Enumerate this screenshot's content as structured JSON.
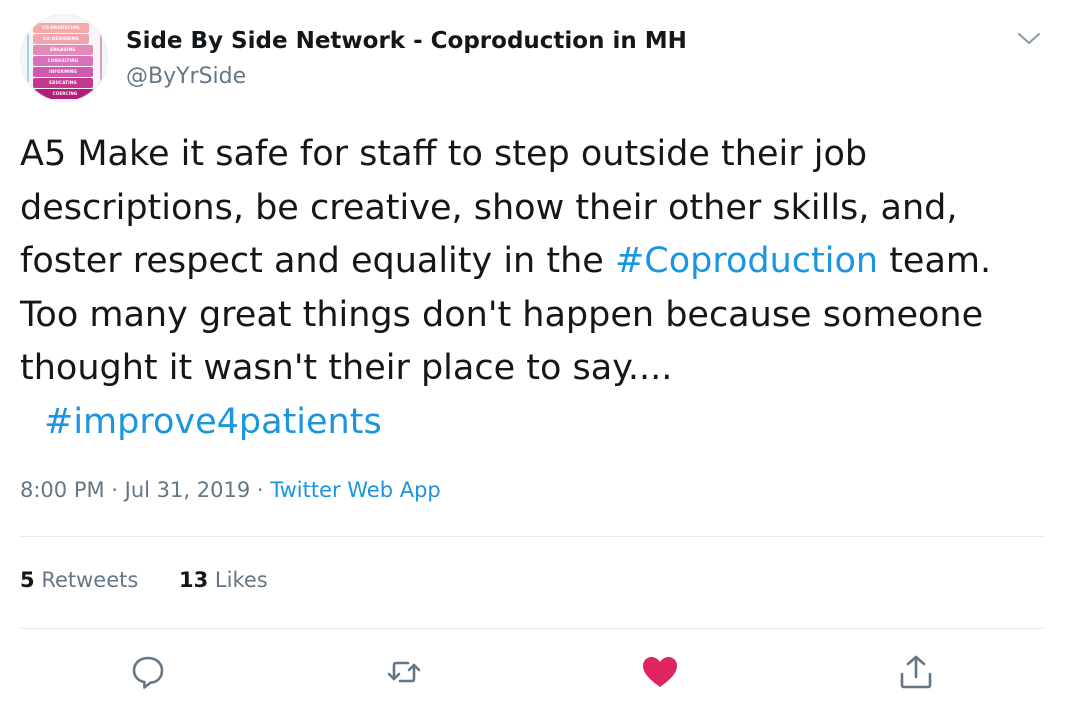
{
  "author": {
    "name": "Side By Side Network - Coproduction in MH",
    "handle": "@ByYrSide",
    "avatar_bars": [
      {
        "label": "CO-PRODUCING",
        "color": "#f7a8a8"
      },
      {
        "label": "CO-DESIGNING",
        "color": "#f3a3b0"
      },
      {
        "label": "ENGAGING",
        "color": "#e48ab9"
      },
      {
        "label": "CONSULTING",
        "color": "#d871b8"
      },
      {
        "label": "INFORMING",
        "color": "#cf5aad"
      },
      {
        "label": "EDUCATING",
        "color": "#c0398f"
      },
      {
        "label": "COERCING",
        "color": "#b01d7a"
      }
    ]
  },
  "tweet": {
    "lines": [
      {
        "parts": [
          {
            "text": "A5 Make it safe for staff to step outside their job",
            "type": "text"
          }
        ]
      },
      {
        "parts": [
          {
            "text": "descriptions, be creative, show their other skills, and,",
            "type": "text"
          }
        ]
      },
      {
        "parts": [
          {
            "text": "foster respect and equality in the ",
            "type": "text"
          },
          {
            "text": "#Coproduction",
            "type": "hashtag"
          },
          {
            "text": " team.",
            "type": "text"
          }
        ]
      },
      {
        "parts": [
          {
            "text": "Too many great things don't happen because someone",
            "type": "text"
          }
        ]
      },
      {
        "parts": [
          {
            "text": "thought it wasn't their place to say....",
            "type": "text"
          }
        ]
      },
      {
        "parts": [
          {
            "text": "#improve4patients",
            "type": "hashtag"
          }
        ],
        "indent": true
      }
    ]
  },
  "meta": {
    "time": "8:00 PM",
    "separator1": " · ",
    "date": "Jul 31, 2019",
    "separator2": " · ",
    "source": "Twitter Web App"
  },
  "stats": {
    "retweets_count": "5",
    "retweets_label": "Retweets",
    "likes_count": "13",
    "likes_label": "Likes"
  },
  "actions": [
    {
      "name": "reply-icon",
      "color": "#657786"
    },
    {
      "name": "retweet-icon",
      "color": "#657786"
    },
    {
      "name": "like-icon",
      "color": "#e0245e"
    },
    {
      "name": "share-icon",
      "color": "#657786"
    }
  ],
  "colors": {
    "link": "#1b95e0",
    "secondary_text": "#657786",
    "primary_text": "#14171a",
    "like_active": "#e0245e",
    "divider": "#e6ecf0"
  }
}
